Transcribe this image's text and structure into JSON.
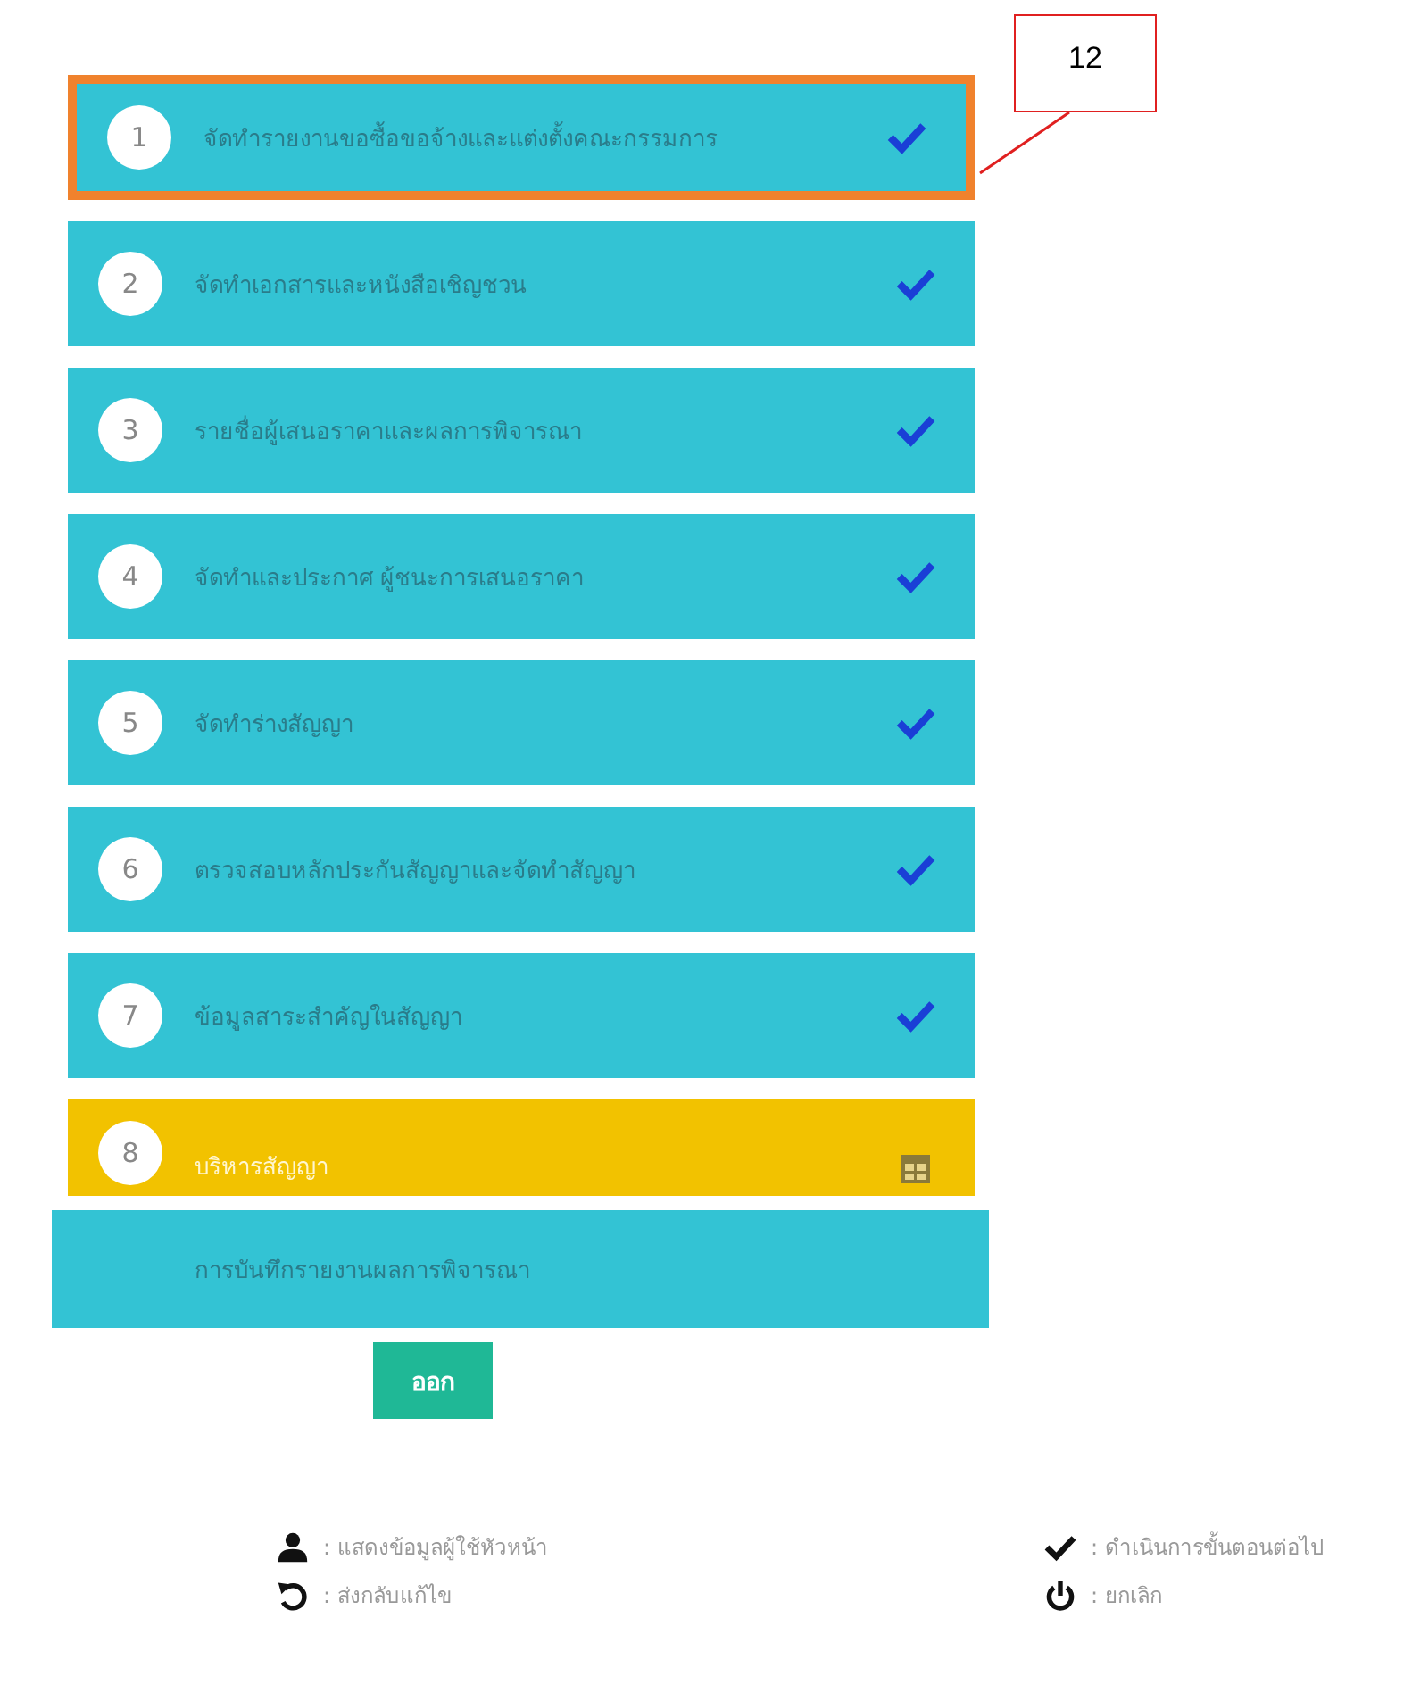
{
  "steps": [
    {
      "number": "1",
      "label": "จัดทำรายงานขอซื้อขอจ้างและแต่งตั้งคณะกรรมการ",
      "kind": "done",
      "selected": true
    },
    {
      "number": "2",
      "label": "จัดทำเอกสารและหนังสือเชิญชวน",
      "kind": "done",
      "selected": false
    },
    {
      "number": "3",
      "label": "รายชื่อผู้เสนอราคาและผลการพิจารณา",
      "kind": "done",
      "selected": false
    },
    {
      "number": "4",
      "label": "จัดทำและประกาศ ผู้ชนะการเสนอราคา",
      "kind": "done",
      "selected": false
    },
    {
      "number": "5",
      "label": "จัดทำร่างสัญญา",
      "kind": "done",
      "selected": false
    },
    {
      "number": "6",
      "label": "ตรวจสอบหลักประกันสัญญาและจัดทำสัญญา",
      "kind": "done",
      "selected": false
    },
    {
      "number": "7",
      "label": "ข้อมูลสาระสำคัญในสัญญา",
      "kind": "done",
      "selected": false
    },
    {
      "number": "8",
      "label": "บริหารสัญญา",
      "kind": "current",
      "selected": false
    }
  ],
  "summary": "การบันทึกรายงานผลการพิจารณา",
  "exit_button": "ออก",
  "legend": [
    {
      "kind": "user",
      "label": ": แสดงข้อมูลผู้ใช้หัวหน้า"
    },
    {
      "kind": "check",
      "label": ": ดำเนินการขั้นตอนต่อไป"
    },
    {
      "kind": "undo",
      "label": ": ส่งกลับแก้ไข"
    },
    {
      "kind": "power",
      "label": ": ยกเลิก"
    }
  ],
  "callout": "12"
}
